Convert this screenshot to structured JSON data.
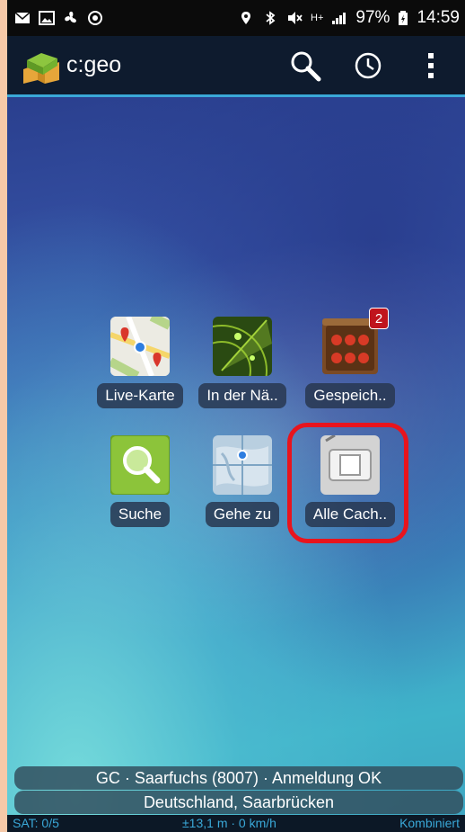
{
  "status_bar": {
    "battery": "97%",
    "time": "14:59",
    "network": "H+"
  },
  "action_bar": {
    "title": "c:geo",
    "search_icon": "search-icon",
    "history_icon": "clock-icon",
    "menu_icon": "overflow-menu-icon"
  },
  "tiles": [
    {
      "label": "Live-Karte",
      "icon": "map-icon"
    },
    {
      "label": "In der Nä..",
      "icon": "radar-icon"
    },
    {
      "label": "Gespeich..",
      "icon": "stored-caches-icon",
      "badge": "2"
    },
    {
      "label": "Suche",
      "icon": "magnifier-icon"
    },
    {
      "label": "Gehe zu",
      "icon": "globe-target-icon"
    },
    {
      "label": "Alle Cach..",
      "icon": "all-caches-icon"
    }
  ],
  "info": {
    "login": "GC · Saarfuchs (8007) · Anmeldung OK",
    "location": "Deutschland, Saarbrücken"
  },
  "bottom": {
    "satellites": "SAT: 0/5",
    "accuracy": "±13,1 m · 0 km/h",
    "mode": "Kombiniert"
  },
  "colors": {
    "accent": "#3aa8d8",
    "highlight": "#e8141d",
    "badge": "#c0141d"
  }
}
